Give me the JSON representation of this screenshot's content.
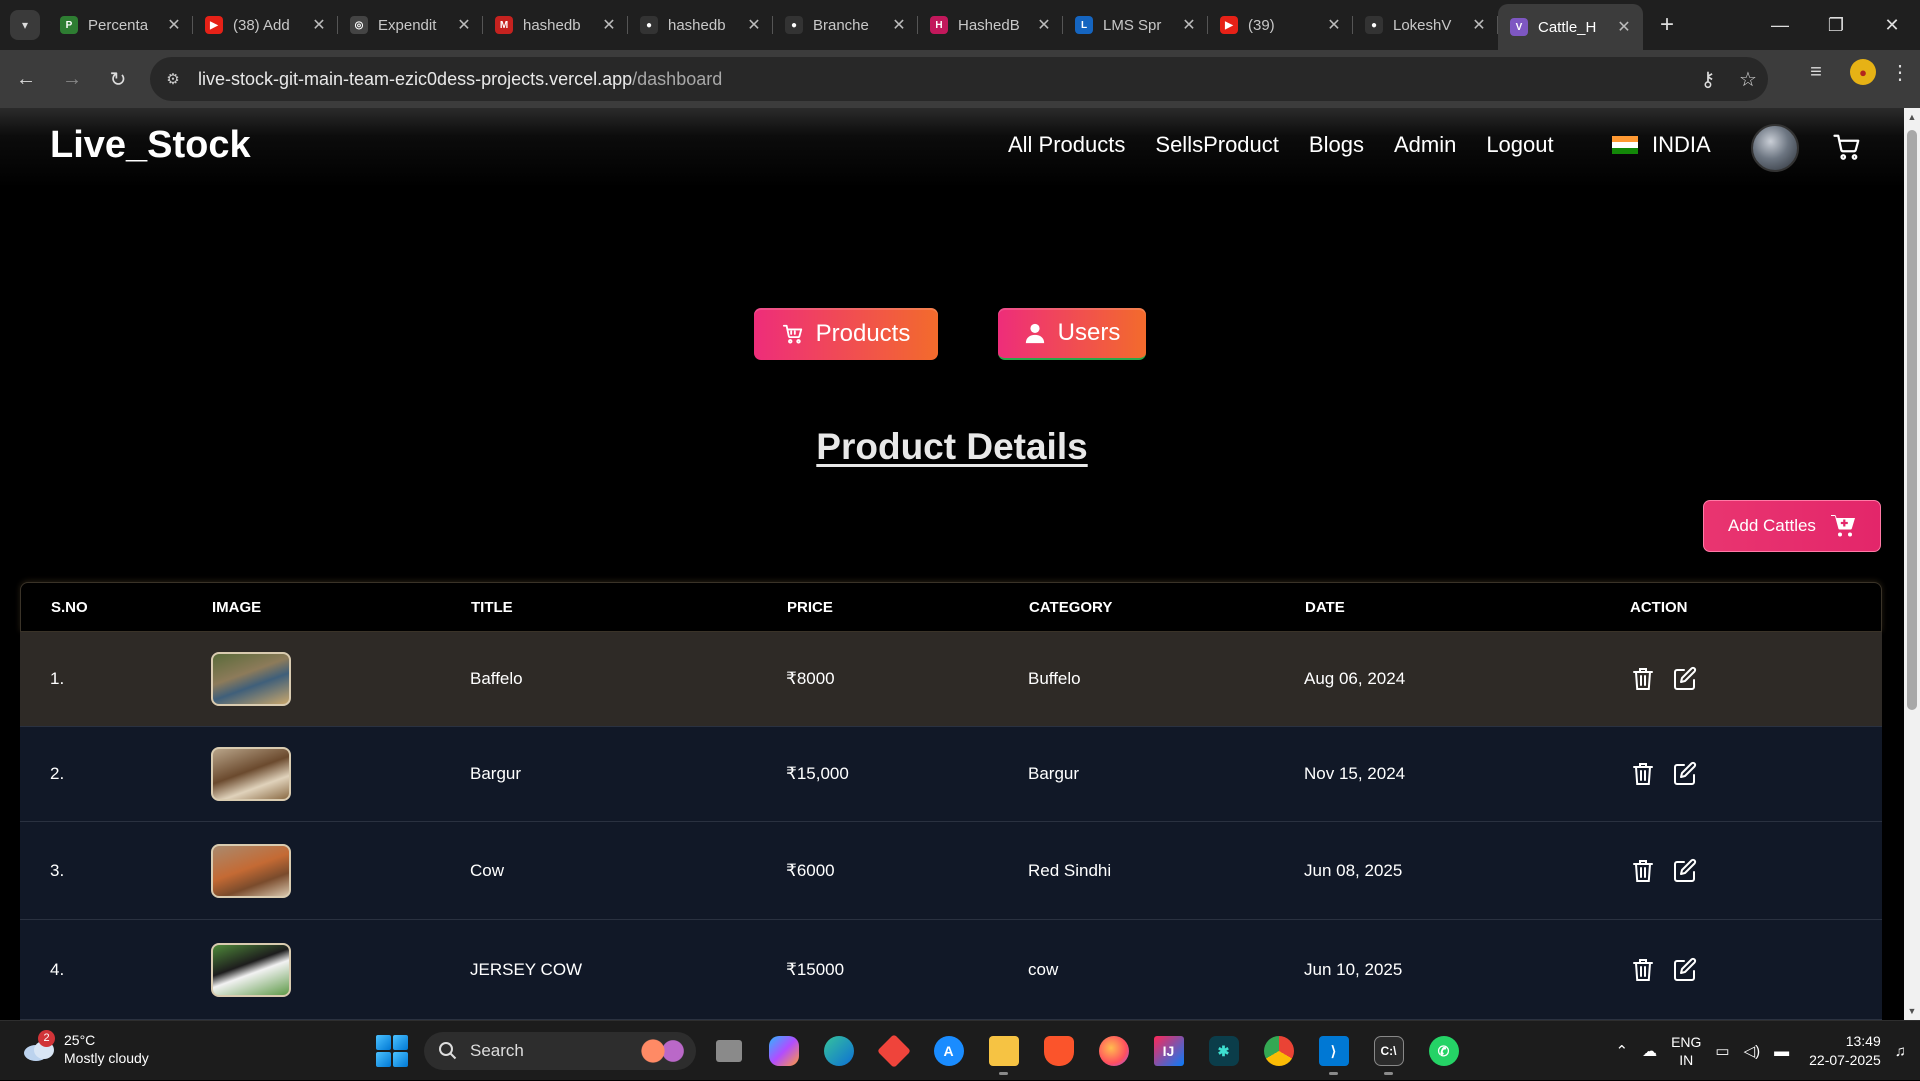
{
  "browser": {
    "tabs": [
      {
        "title": "Percenta",
        "color": "#2e7d32",
        "glyph": "P"
      },
      {
        "title": "(38) Add",
        "color": "#e62117",
        "glyph": "▶"
      },
      {
        "title": "Expendit",
        "color": "#444444",
        "glyph": "◎"
      },
      {
        "title": "hashedb",
        "color": "#c5221f",
        "glyph": "M"
      },
      {
        "title": "hashedb",
        "color": "#333333",
        "glyph": "●"
      },
      {
        "title": "Branche",
        "color": "#333333",
        "glyph": "●"
      },
      {
        "title": "HashedB",
        "color": "#c2185b",
        "glyph": "H"
      },
      {
        "title": "LMS Spr",
        "color": "#1565c0",
        "glyph": "L"
      },
      {
        "title": "(39)",
        "color": "#e62117",
        "glyph": "▶"
      },
      {
        "title": "LokeshV",
        "color": "#333333",
        "glyph": "●"
      },
      {
        "title": "Cattle_H",
        "color": "#7e57c2",
        "glyph": "V"
      }
    ],
    "active_tab_index": 10,
    "url_host": "live-stock-git-main-team-ezic0dess-projects.vercel.app",
    "url_path": "/dashboard"
  },
  "site": {
    "brand": "Live_Stock",
    "nav": {
      "all_products": "All Products",
      "sells_product": "SellsProduct",
      "blogs": "Blogs",
      "admin": "Admin",
      "logout": "Logout",
      "country": "INDIA"
    }
  },
  "dashboard": {
    "products_button": "Products",
    "users_button": "Users",
    "section_title": "Product Details",
    "add_button": "Add Cattles",
    "table": {
      "headers": [
        "S.NO",
        "IMAGE",
        "TITLE",
        "PRICE",
        "CATEGORY",
        "DATE",
        "ACTION"
      ],
      "rows": [
        {
          "sno": "1.",
          "title": "Baffelo",
          "price": "₹8000",
          "category": "Buffelo",
          "date": "Aug 06, 2024"
        },
        {
          "sno": "2.",
          "title": "Bargur",
          "price": "₹15,000",
          "category": "Bargur",
          "date": "Nov 15, 2024"
        },
        {
          "sno": "3.",
          "title": "Cow",
          "price": "₹6000",
          "category": "Red Sindhi",
          "date": "Jun 08, 2025"
        },
        {
          "sno": "4.",
          "title": "JERSEY COW",
          "price": "₹15000",
          "category": "cow",
          "date": "Jun 10, 2025"
        }
      ]
    }
  },
  "taskbar": {
    "weather_temp": "25°C",
    "weather_desc": "Mostly cloudy",
    "weather_badge": "2",
    "search_placeholder": "Search",
    "lang_line1": "ENG",
    "lang_line2": "IN",
    "time": "13:49",
    "date": "22-07-2025"
  },
  "colors": {
    "accent_gradient_start": "#ee2d7a",
    "accent_gradient_end": "#f36b2c",
    "row_highlight": "#2e2a26",
    "row_default": "#111827"
  }
}
